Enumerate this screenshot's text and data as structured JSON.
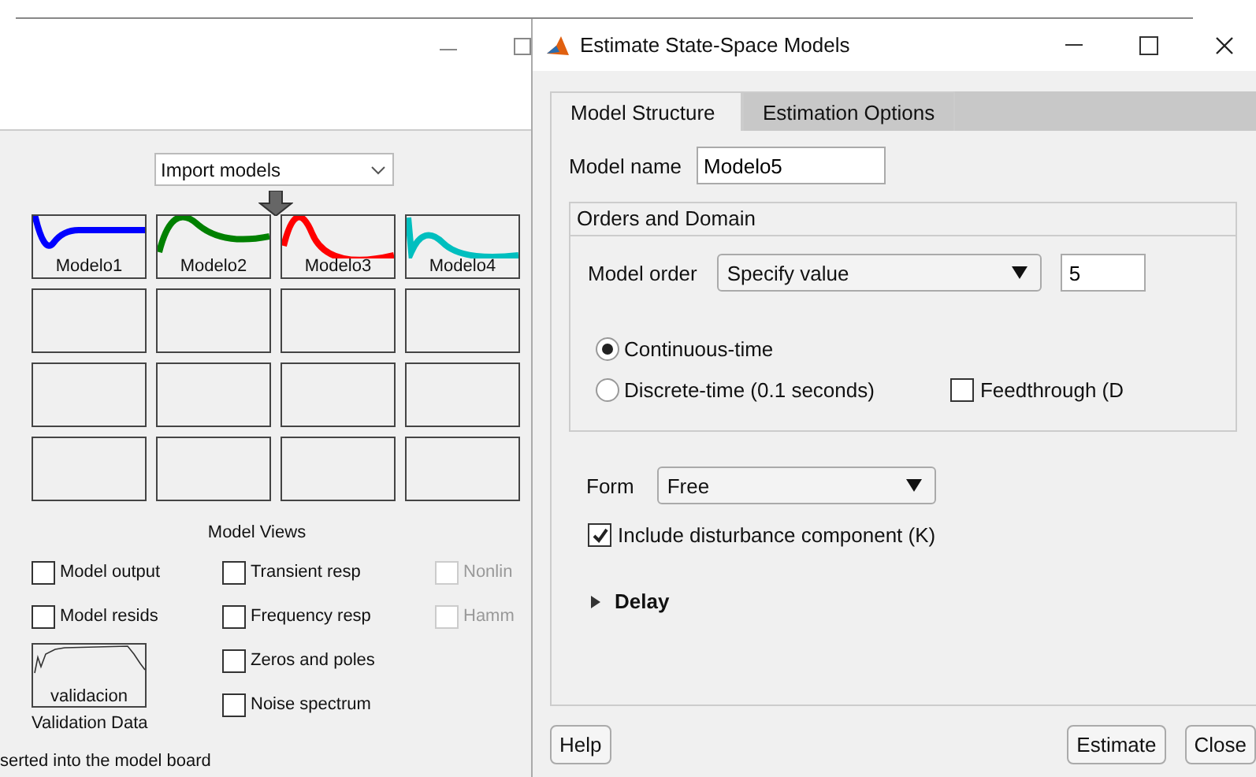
{
  "main_window": {
    "import_dropdown": {
      "value": "Import models"
    },
    "models": [
      {
        "name": "Modelo1",
        "color": "#0000ff"
      },
      {
        "name": "Modelo2",
        "color": "#008000"
      },
      {
        "name": "Modelo3",
        "color": "#ff0000"
      },
      {
        "name": "Modelo4",
        "color": "#00bfbf"
      }
    ],
    "model_views": {
      "title": "Model Views",
      "columns": [
        [
          {
            "label": "Model output",
            "checked": false,
            "disabled": false
          },
          {
            "label": "Model resids",
            "checked": false,
            "disabled": false
          }
        ],
        [
          {
            "label": "Transient resp",
            "checked": false,
            "disabled": false
          },
          {
            "label": "Frequency resp",
            "checked": false,
            "disabled": false
          },
          {
            "label": "Zeros and poles",
            "checked": false,
            "disabled": false
          },
          {
            "label": "Noise spectrum",
            "checked": false,
            "disabled": false
          }
        ],
        [
          {
            "label": "Nonlin",
            "checked": false,
            "disabled": true
          },
          {
            "label": "Hamm",
            "checked": false,
            "disabled": true
          }
        ]
      ]
    },
    "validation": {
      "name": "validacion",
      "caption": "Validation Data"
    },
    "status": "serted into the model board"
  },
  "dialog": {
    "title": "Estimate State-Space Models",
    "tabs": [
      {
        "label": "Model Structure",
        "selected": true
      },
      {
        "label": "Estimation Options",
        "selected": false
      }
    ],
    "model_name": {
      "label": "Model name",
      "value": "Modelo5"
    },
    "orders": {
      "title": "Orders and Domain",
      "model_order_label": "Model order",
      "model_order_dropdown": "Specify value",
      "model_order_value": "5",
      "domains": [
        {
          "label": "Continuous-time",
          "selected": true
        },
        {
          "label": "Discrete-time (0.1 seconds)",
          "selected": false
        }
      ],
      "feedthrough": {
        "label": "Feedthrough (D",
        "checked": false
      }
    },
    "form": {
      "label": "Form",
      "value": "Free"
    },
    "disturbance": {
      "label": "Include disturbance component (K)",
      "checked": true
    },
    "delay": {
      "label": "Delay",
      "expanded": false
    },
    "buttons": [
      {
        "label": "Help"
      },
      {
        "label": "Estimate"
      },
      {
        "label": "Close"
      }
    ]
  }
}
